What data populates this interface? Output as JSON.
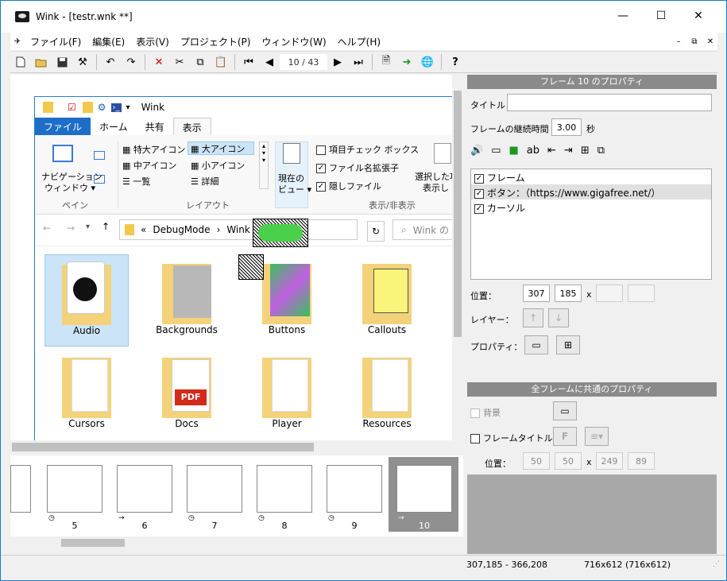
{
  "app": {
    "title": "Wink - [testr.wnk **]",
    "min": "—",
    "max": "☐",
    "close": "✕"
  },
  "menu": [
    "ファイル(F)",
    "編集(E)",
    "表示(V)",
    "プロジェクト(P)",
    "ウィンドウ(W)",
    "ヘルプ(H)"
  ],
  "mdi": {
    "min": "–",
    "restore": "⧉",
    "close": "✕"
  },
  "toolbar": {
    "frame_counter": "10 / 43"
  },
  "explorer": {
    "title": "Wink",
    "tabs": [
      "ファイル",
      "ホーム",
      "共有",
      "表示"
    ],
    "ribbon": {
      "pane_label": "ペイン",
      "nav_pane": "ナビゲーション",
      "nav_pane2": "ウィンドウ ▾",
      "layout_label": "レイアウト",
      "layout_items": [
        "特大アイコン",
        "大アイコン",
        "中アイコン",
        "小アイコン",
        "一覧",
        "詳細"
      ],
      "current_view": "現在の",
      "current_view2": "ビュー ▾",
      "show_label": "表示/非表示",
      "checks": [
        {
          "label": "項目チェック ボックス",
          "checked": false
        },
        {
          "label": "ファイル名拡張子",
          "checked": true
        },
        {
          "label": "隠しファイル",
          "checked": true
        }
      ],
      "selected_hide": "選択した項",
      "selected_hide2": "表示し"
    },
    "address": {
      "prefix": "«",
      "path1": "DebugMode",
      "sep": "›",
      "path2": "Wink",
      "search": "Wink の"
    },
    "folders": [
      "Audio",
      "Backgrounds",
      "Buttons",
      "Callouts",
      "Cursors",
      "Docs",
      "Player",
      "Resources"
    ]
  },
  "filmstrip": {
    "frames": [
      "5",
      "6",
      "7",
      "8",
      "9",
      "10"
    ]
  },
  "status": {
    "coords": "307,185 - 366,208",
    "size": "716x612 (716x612)"
  },
  "props": {
    "header": "フレーム 10 のプロパティ",
    "title_label": "タイトル",
    "title_value": "",
    "duration_label": "フレームの継続時間",
    "duration_value": "3.00",
    "duration_unit": "秒",
    "objects": [
      {
        "label": "フレーム",
        "checked": true
      },
      {
        "label": "ボタン：（https://www.gigafree.net/）",
        "checked": true
      },
      {
        "label": "カーソル",
        "checked": true
      }
    ],
    "pos_label": "位置：",
    "pos_x": "307",
    "pos_y": "185",
    "pos_x_sep": "x",
    "pos_w": "",
    "pos_h": "",
    "layer_label": "レイヤー：",
    "property_label": "プロパティ："
  },
  "common": {
    "header": "全フレームに共通のプロパティ",
    "bg_label": "背景",
    "frame_title_label": "フレームタイトル",
    "frame_title_btn": "F",
    "pos_label": "位置：",
    "x": "50",
    "y": "50",
    "sep": "x",
    "w": "249",
    "h": "89"
  }
}
